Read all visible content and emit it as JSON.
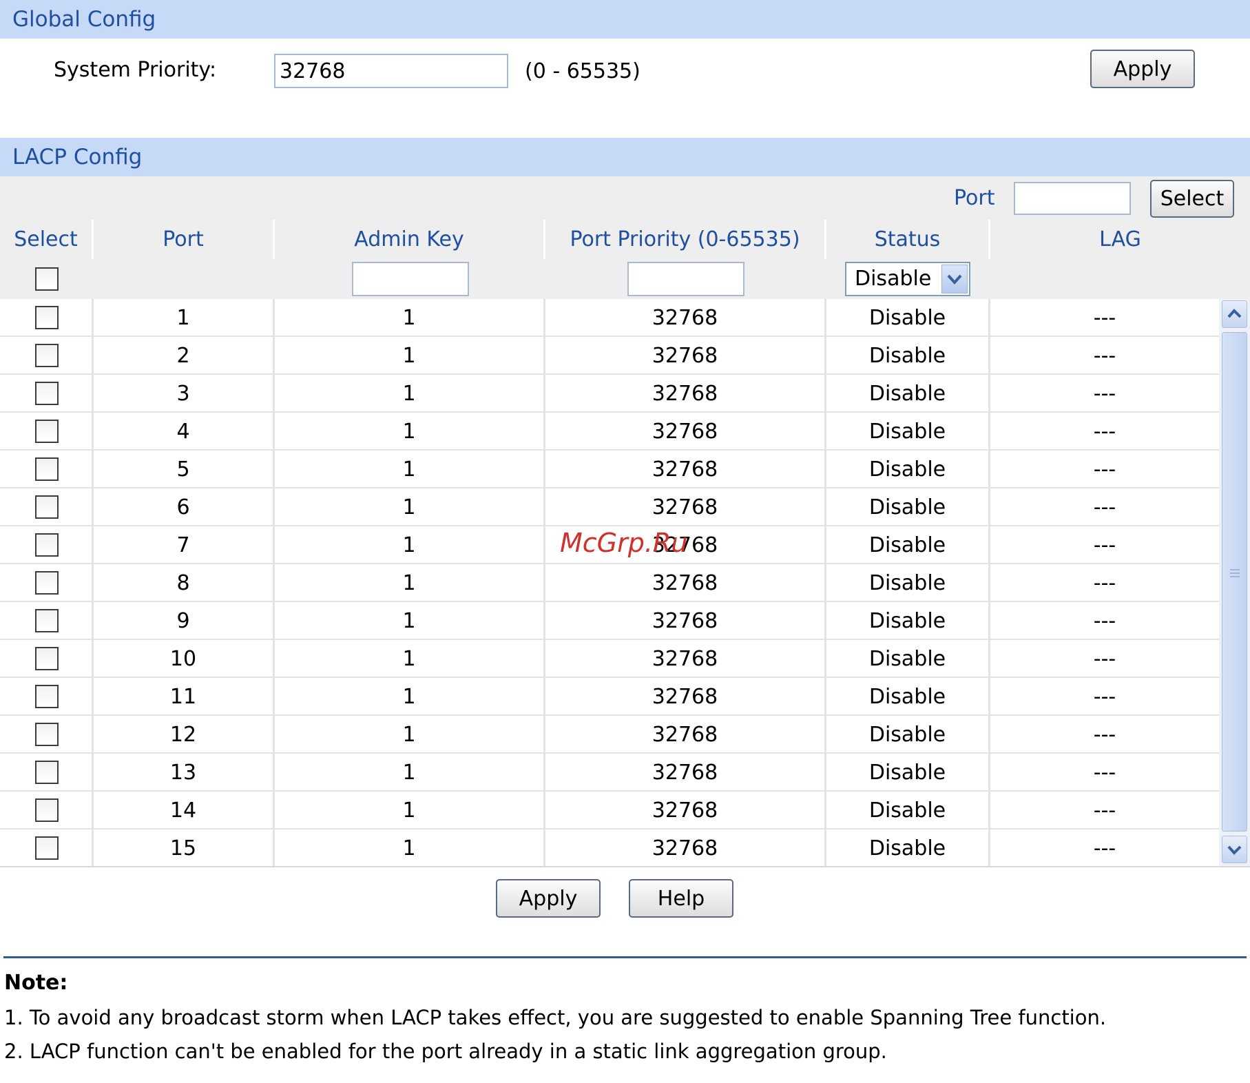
{
  "global_config": {
    "title": "Global Config",
    "system_priority_label": "System Priority:",
    "system_priority_value": "32768",
    "range_hint": "(0 - 65535)",
    "apply_label": "Apply"
  },
  "lacp_config": {
    "title": "LACP Config",
    "port_filter_label": "Port",
    "port_filter_value": "",
    "select_button_label": "Select",
    "columns": [
      "Select",
      "Port",
      "Admin Key",
      "Port Priority (0-65535)",
      "Status",
      "LAG"
    ],
    "bulk_edit": {
      "admin_key_value": "",
      "port_priority_value": "",
      "status_selected": "Disable"
    },
    "rows": [
      {
        "port": "1",
        "admin_key": "1",
        "priority": "32768",
        "status": "Disable",
        "lag": "---"
      },
      {
        "port": "2",
        "admin_key": "1",
        "priority": "32768",
        "status": "Disable",
        "lag": "---"
      },
      {
        "port": "3",
        "admin_key": "1",
        "priority": "32768",
        "status": "Disable",
        "lag": "---"
      },
      {
        "port": "4",
        "admin_key": "1",
        "priority": "32768",
        "status": "Disable",
        "lag": "---"
      },
      {
        "port": "5",
        "admin_key": "1",
        "priority": "32768",
        "status": "Disable",
        "lag": "---"
      },
      {
        "port": "6",
        "admin_key": "1",
        "priority": "32768",
        "status": "Disable",
        "lag": "---"
      },
      {
        "port": "7",
        "admin_key": "1",
        "priority": "32768",
        "status": "Disable",
        "lag": "---"
      },
      {
        "port": "8",
        "admin_key": "1",
        "priority": "32768",
        "status": "Disable",
        "lag": "---"
      },
      {
        "port": "9",
        "admin_key": "1",
        "priority": "32768",
        "status": "Disable",
        "lag": "---"
      },
      {
        "port": "10",
        "admin_key": "1",
        "priority": "32768",
        "status": "Disable",
        "lag": "---"
      },
      {
        "port": "11",
        "admin_key": "1",
        "priority": "32768",
        "status": "Disable",
        "lag": "---"
      },
      {
        "port": "12",
        "admin_key": "1",
        "priority": "32768",
        "status": "Disable",
        "lag": "---"
      },
      {
        "port": "13",
        "admin_key": "1",
        "priority": "32768",
        "status": "Disable",
        "lag": "---"
      },
      {
        "port": "14",
        "admin_key": "1",
        "priority": "32768",
        "status": "Disable",
        "lag": "---"
      },
      {
        "port": "15",
        "admin_key": "1",
        "priority": "32768",
        "status": "Disable",
        "lag": "---"
      }
    ],
    "apply_label": "Apply",
    "help_label": "Help"
  },
  "watermark": "McGrp.Ru",
  "note": {
    "title": "Note:",
    "items": [
      "1. To avoid any broadcast storm when LACP takes effect, you are suggested to enable Spanning Tree function.",
      "2. LACP function can't be enabled for the port already in a static link aggregation group."
    ]
  },
  "colors": {
    "section_bar": "#c6d9f7",
    "header_text": "#1f4fa0",
    "watermark": "#d0312d"
  },
  "icons": [
    "chevron-down-icon",
    "scroll-up-arrow-icon",
    "scroll-down-arrow-icon",
    "scroll-grip-icon"
  ]
}
